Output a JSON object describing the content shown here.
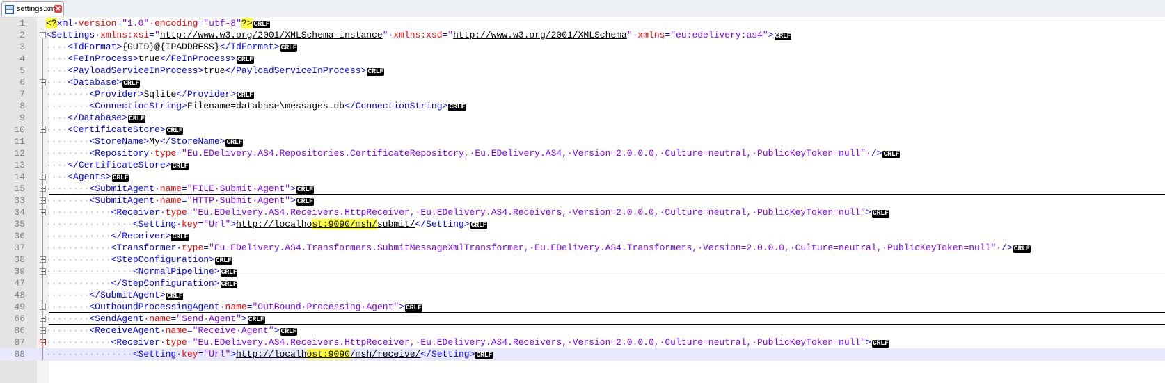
{
  "tab": {
    "title": "settings.xml",
    "icon": "xml-file-icon",
    "close_icon": "close-icon"
  },
  "colors": {
    "tag": "#0000ff",
    "attr": "#ff0000",
    "value": "#8000ff",
    "text": "#000000",
    "whitespace": "#b5b5b5",
    "highlight": "#ffff33",
    "current_line": "#e8e8ff",
    "gutter": "#e4e4e4"
  },
  "eol_marker": "CRLF",
  "current_line": 88,
  "lines": [
    {
      "num": "1",
      "indent": 0,
      "fold": "none",
      "segs": [
        [
          "hl",
          "<?"
        ],
        [
          "tag",
          "xml "
        ],
        [
          "attr",
          "version"
        ],
        [
          "punct",
          "="
        ],
        [
          "val",
          "\"1.0\" "
        ],
        [
          "attr",
          "encoding"
        ],
        [
          "punct",
          "="
        ],
        [
          "val",
          "\"utf-8\""
        ],
        [
          "hl",
          "?>"
        ]
      ]
    },
    {
      "num": "2",
      "indent": 0,
      "fold": "minus",
      "segs": [
        [
          "tag",
          "<Settings "
        ],
        [
          "attr",
          "xmlns:xsi"
        ],
        [
          "punct",
          "="
        ],
        [
          "val",
          "\""
        ],
        [
          "link",
          "http://www.w3.org/2001/XMLSchema-instance"
        ],
        [
          "val",
          "\" "
        ],
        [
          "attr",
          "xmlns:xsd"
        ],
        [
          "punct",
          "="
        ],
        [
          "val",
          "\""
        ],
        [
          "link",
          "http://www.w3.org/2001/XMLSchema"
        ],
        [
          "val",
          "\" "
        ],
        [
          "attr",
          "xmlns"
        ],
        [
          "punct",
          "="
        ],
        [
          "val",
          "\"eu:edelivery:as4\""
        ],
        [
          "tag",
          ">"
        ]
      ]
    },
    {
      "num": "3",
      "indent": 1,
      "fold": "none",
      "segs": [
        [
          "tag",
          "<IdFormat>"
        ],
        [
          "txt",
          "{GUID}@{IPADDRESS}"
        ],
        [
          "tag",
          "</IdFormat>"
        ]
      ]
    },
    {
      "num": "4",
      "indent": 1,
      "fold": "none",
      "segs": [
        [
          "tag",
          "<FeInProcess>"
        ],
        [
          "txt",
          "true"
        ],
        [
          "tag",
          "</FeInProcess>"
        ]
      ]
    },
    {
      "num": "5",
      "indent": 1,
      "fold": "none",
      "segs": [
        [
          "tag",
          "<PayloadServiceInProcess>"
        ],
        [
          "txt",
          "true"
        ],
        [
          "tag",
          "</PayloadServiceInProcess>"
        ]
      ]
    },
    {
      "num": "6",
      "indent": 1,
      "fold": "minus",
      "segs": [
        [
          "tag",
          "<Database>"
        ]
      ]
    },
    {
      "num": "7",
      "indent": 2,
      "fold": "none",
      "segs": [
        [
          "tag",
          "<Provider>"
        ],
        [
          "txt",
          "Sqlite"
        ],
        [
          "tag",
          "</Provider>"
        ]
      ]
    },
    {
      "num": "8",
      "indent": 2,
      "fold": "none",
      "segs": [
        [
          "tag",
          "<ConnectionString>"
        ],
        [
          "txt",
          "Filename=database\\messages.db"
        ],
        [
          "tag",
          "</ConnectionString>"
        ]
      ]
    },
    {
      "num": "9",
      "indent": 1,
      "fold": "none",
      "segs": [
        [
          "tag",
          "</Database>"
        ]
      ]
    },
    {
      "num": "10",
      "indent": 1,
      "fold": "minus",
      "segs": [
        [
          "tag",
          "<CertificateStore>"
        ]
      ]
    },
    {
      "num": "11",
      "indent": 2,
      "fold": "none",
      "segs": [
        [
          "tag",
          "<StoreName>"
        ],
        [
          "txt",
          "My"
        ],
        [
          "tag",
          "</StoreName>"
        ]
      ]
    },
    {
      "num": "12",
      "indent": 2,
      "fold": "none",
      "segs": [
        [
          "tag",
          "<Repository "
        ],
        [
          "attr",
          "type"
        ],
        [
          "punct",
          "="
        ],
        [
          "val",
          "\"Eu.EDelivery.AS4.Repositories.CertificateRepository, Eu.EDelivery.AS4, Version=2.0.0.0, Culture=neutral, PublicKeyToken=null\" "
        ],
        [
          "tag",
          "/>"
        ]
      ]
    },
    {
      "num": "13",
      "indent": 1,
      "fold": "none",
      "segs": [
        [
          "tag",
          "</CertificateStore>"
        ]
      ]
    },
    {
      "num": "14",
      "indent": 1,
      "fold": "minus",
      "segs": [
        [
          "tag",
          "<Agents>"
        ]
      ]
    },
    {
      "num": "15",
      "indent": 2,
      "fold": "plus",
      "segs": [
        [
          "tag",
          "<SubmitAgent "
        ],
        [
          "attr",
          "name"
        ],
        [
          "punct",
          "="
        ],
        [
          "val",
          "\"FILE Submit Agent\""
        ],
        [
          "tag",
          ">"
        ]
      ]
    },
    {
      "num": "33",
      "indent": 2,
      "fold": "minus",
      "segs": [
        [
          "tag",
          "<SubmitAgent "
        ],
        [
          "attr",
          "name"
        ],
        [
          "punct",
          "="
        ],
        [
          "val",
          "\"HTTP Submit Agent\""
        ],
        [
          "tag",
          ">"
        ]
      ]
    },
    {
      "num": "34",
      "indent": 3,
      "fold": "minus",
      "segs": [
        [
          "tag",
          "<Receiver "
        ],
        [
          "attr",
          "type"
        ],
        [
          "punct",
          "="
        ],
        [
          "val",
          "\"Eu.EDelivery.AS4.Receivers.HttpReceiver, Eu.EDelivery.AS4.Receivers, Version=2.0.0.0, Culture=neutral, PublicKeyToken=null\""
        ],
        [
          "tag",
          ">"
        ]
      ]
    },
    {
      "num": "35",
      "indent": 4,
      "fold": "none",
      "segs": [
        [
          "tag",
          "<Setting "
        ],
        [
          "attr",
          "key"
        ],
        [
          "punct",
          "="
        ],
        [
          "val",
          "\"Url\""
        ],
        [
          "tag",
          ">"
        ],
        [
          "link",
          "http://localho"
        ],
        [
          "linkhl",
          "st:9090/msh/"
        ],
        [
          "link",
          "submit/"
        ],
        [
          "tag",
          "</Setting>"
        ]
      ]
    },
    {
      "num": "36",
      "indent": 3,
      "fold": "none",
      "segs": [
        [
          "tag",
          "</Receiver>"
        ]
      ]
    },
    {
      "num": "37",
      "indent": 3,
      "fold": "none",
      "segs": [
        [
          "tag",
          "<Transformer "
        ],
        [
          "attr",
          "type"
        ],
        [
          "punct",
          "="
        ],
        [
          "val",
          "\"Eu.EDelivery.AS4.Transformers.SubmitMessageXmlTransformer, Eu.EDelivery.AS4.Transformers, Version=2.0.0.0, Culture=neutral, PublicKeyToken=null\" "
        ],
        [
          "tag",
          "/>"
        ]
      ]
    },
    {
      "num": "38",
      "indent": 3,
      "fold": "minus",
      "segs": [
        [
          "tag",
          "<StepConfiguration>"
        ]
      ]
    },
    {
      "num": "39",
      "indent": 4,
      "fold": "plus",
      "segs": [
        [
          "tag",
          "<NormalPipeline>"
        ]
      ]
    },
    {
      "num": "47",
      "indent": 3,
      "fold": "none",
      "segs": [
        [
          "tag",
          "</StepConfiguration>"
        ]
      ]
    },
    {
      "num": "48",
      "indent": 2,
      "fold": "none",
      "segs": [
        [
          "tag",
          "</SubmitAgent>"
        ]
      ]
    },
    {
      "num": "49",
      "indent": 2,
      "fold": "plus",
      "segs": [
        [
          "tag",
          "<OutboundProcessingAgent "
        ],
        [
          "attr",
          "name"
        ],
        [
          "punct",
          "="
        ],
        [
          "val",
          "\"OutBound Processing Agent\""
        ],
        [
          "tag",
          ">"
        ]
      ]
    },
    {
      "num": "66",
      "indent": 2,
      "fold": "plus",
      "segs": [
        [
          "tag",
          "<SendAgent "
        ],
        [
          "attr",
          "name"
        ],
        [
          "punct",
          "="
        ],
        [
          "val",
          "\"Send Agent\""
        ],
        [
          "tag",
          ">"
        ]
      ]
    },
    {
      "num": "86",
      "indent": 2,
      "fold": "minus",
      "segs": [
        [
          "tag",
          "<ReceiveAgent "
        ],
        [
          "attr",
          "name"
        ],
        [
          "punct",
          "="
        ],
        [
          "val",
          "\"Receive Agent\""
        ],
        [
          "tag",
          ">"
        ]
      ]
    },
    {
      "num": "87",
      "indent": 3,
      "fold": "minus-red",
      "segs": [
        [
          "tag",
          "<Receiver "
        ],
        [
          "attr",
          "type"
        ],
        [
          "punct",
          "="
        ],
        [
          "val",
          "\"Eu.EDelivery.AS4.Receivers.HttpReceiver, Eu.EDelivery.AS4.Receivers, Version=2.0.0.0, Culture=neutral, PublicKeyToken=null\""
        ],
        [
          "tag",
          ">"
        ]
      ]
    },
    {
      "num": "88",
      "indent": 4,
      "fold": "none",
      "segs": [
        [
          "tag",
          "<Setting "
        ],
        [
          "attr",
          "key"
        ],
        [
          "punct",
          "="
        ],
        [
          "val",
          "\"Url\""
        ],
        [
          "tag",
          ">"
        ],
        [
          "link",
          "http://localh"
        ],
        [
          "linkhl",
          "ost:9090"
        ],
        [
          "link",
          "/msh/receive/"
        ],
        [
          "tag",
          "</Setting>"
        ]
      ]
    }
  ]
}
